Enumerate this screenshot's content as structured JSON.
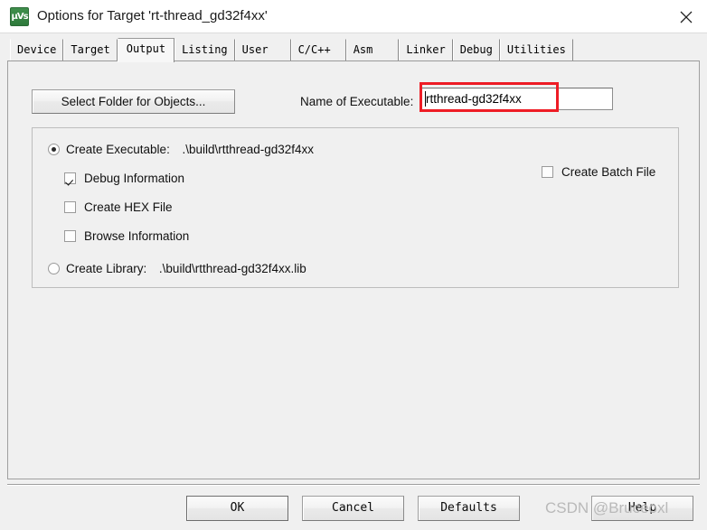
{
  "window": {
    "title": "Options for Target 'rt-thread_gd32f4xx'",
    "icon_name": "keil-uvision-icon",
    "icon_glyph": "μVs",
    "close_label": "✕"
  },
  "tabs": [
    {
      "label": "Device",
      "active": false
    },
    {
      "label": "Target",
      "active": false
    },
    {
      "label": "Output",
      "active": true
    },
    {
      "label": "Listing",
      "active": false
    },
    {
      "label": "User",
      "active": false
    },
    {
      "label": "C/C++",
      "active": false
    },
    {
      "label": "Asm",
      "active": false
    },
    {
      "label": "Linker",
      "active": false
    },
    {
      "label": "Debug",
      "active": false
    },
    {
      "label": "Utilities",
      "active": false
    }
  ],
  "output_tab": {
    "select_folder_button": "Select Folder for Objects...",
    "executable_name_label": "Name of Executable:",
    "executable_name_value": "rtthread-gd32f4xx",
    "highlight_color": "#ee1c25",
    "create_executable": {
      "label": "Create Executable:",
      "path": ".\\build\\rtthread-gd32f4xx",
      "checked": true
    },
    "debug_information": {
      "label": "Debug Information",
      "checked": true
    },
    "create_hex_file": {
      "label": "Create HEX File",
      "checked": false
    },
    "browse_information": {
      "label": "Browse Information",
      "checked": false
    },
    "create_batch_file": {
      "label": "Create Batch File",
      "checked": false
    },
    "create_library": {
      "label": "Create Library:",
      "path": ".\\build\\rtthread-gd32f4xx.lib",
      "checked": false
    }
  },
  "footer": {
    "ok": "OK",
    "cancel": "Cancel",
    "defaults": "Defaults",
    "help": "Help"
  },
  "watermark": "CSDN @Bruceoxl"
}
